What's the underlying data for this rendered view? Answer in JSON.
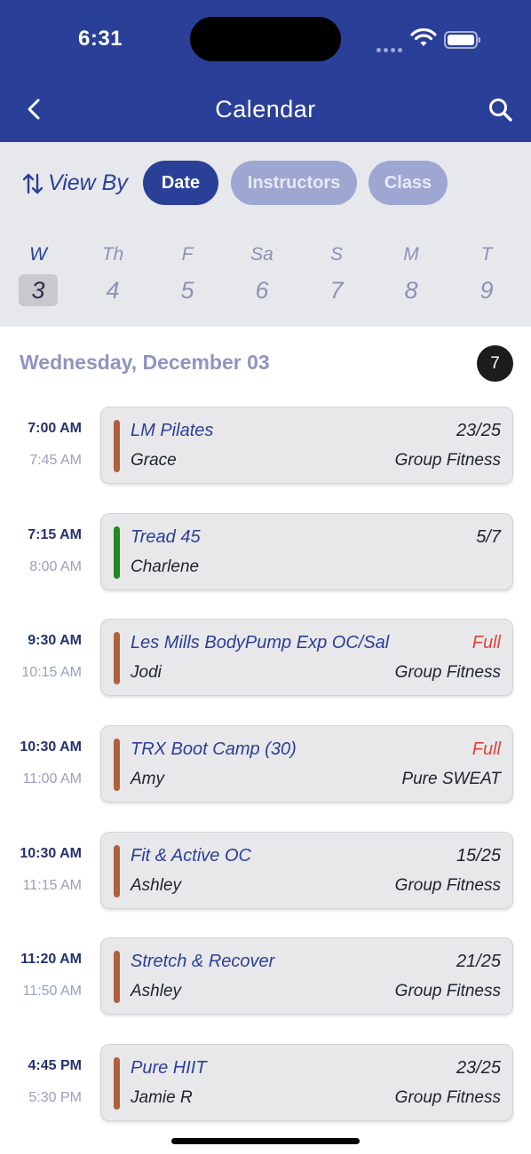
{
  "status": {
    "time": "6:31"
  },
  "header": {
    "title": "Calendar"
  },
  "view_by": {
    "label": "View By",
    "options": [
      {
        "label": "Date",
        "active": true
      },
      {
        "label": "Instructors",
        "active": false
      },
      {
        "label": "Class",
        "active": false
      }
    ]
  },
  "week": [
    {
      "letter": "W",
      "num": "3",
      "selected": true
    },
    {
      "letter": "Th",
      "num": "4",
      "selected": false
    },
    {
      "letter": "F",
      "num": "5",
      "selected": false
    },
    {
      "letter": "Sa",
      "num": "6",
      "selected": false
    },
    {
      "letter": "S",
      "num": "7",
      "selected": false
    },
    {
      "letter": "M",
      "num": "8",
      "selected": false
    },
    {
      "letter": "T",
      "num": "9",
      "selected": false
    }
  ],
  "schedule": {
    "heading": "Wednesday, December 03",
    "count": "7",
    "classes": [
      {
        "start": "7:00 AM",
        "end": "7:45 AM",
        "name": "LM Pilates",
        "capacity": "23/25",
        "instructor": "Grace",
        "category": "Group Fitness",
        "color": "#b0603a",
        "full": false
      },
      {
        "start": "7:15 AM",
        "end": "8:00 AM",
        "name": "Tread 45",
        "capacity": "5/7",
        "instructor": "Charlene",
        "category": "",
        "color": "#1f8a1f",
        "full": false
      },
      {
        "start": "9:30 AM",
        "end": "10:15 AM",
        "name": "Les Mills BodyPump Exp OC/Sal",
        "capacity": "Full",
        "instructor": "Jodi",
        "category": "Group Fitness",
        "color": "#b0603a",
        "full": true
      },
      {
        "start": "10:30 AM",
        "end": "11:00 AM",
        "name": "TRX Boot Camp (30)",
        "capacity": "Full",
        "instructor": "Amy",
        "category": "Pure SWEAT",
        "color": "#b0603a",
        "full": true
      },
      {
        "start": "10:30 AM",
        "end": "11:15 AM",
        "name": "Fit & Active OC",
        "capacity": "15/25",
        "instructor": "Ashley",
        "category": "Group Fitness",
        "color": "#b0603a",
        "full": false
      },
      {
        "start": "11:20 AM",
        "end": "11:50 AM",
        "name": "Stretch & Recover",
        "capacity": "21/25",
        "instructor": "Ashley",
        "category": "Group Fitness",
        "color": "#b0603a",
        "full": false
      },
      {
        "start": "4:45 PM",
        "end": "5:30 PM",
        "name": "Pure HIIT",
        "capacity": "23/25",
        "instructor": "Jamie R",
        "category": "Group Fitness",
        "color": "#b0603a",
        "full": false
      }
    ]
  },
  "icons": {
    "back": "chevron-left-icon",
    "search": "search-icon",
    "sort": "sort-arrows-icon",
    "wifi": "wifi-icon",
    "battery": "battery-icon"
  },
  "colors": {
    "brand": "#2a3f98",
    "full": "#e0403a",
    "bar_default": "#b0603a",
    "bar_green": "#1f8a1f"
  }
}
